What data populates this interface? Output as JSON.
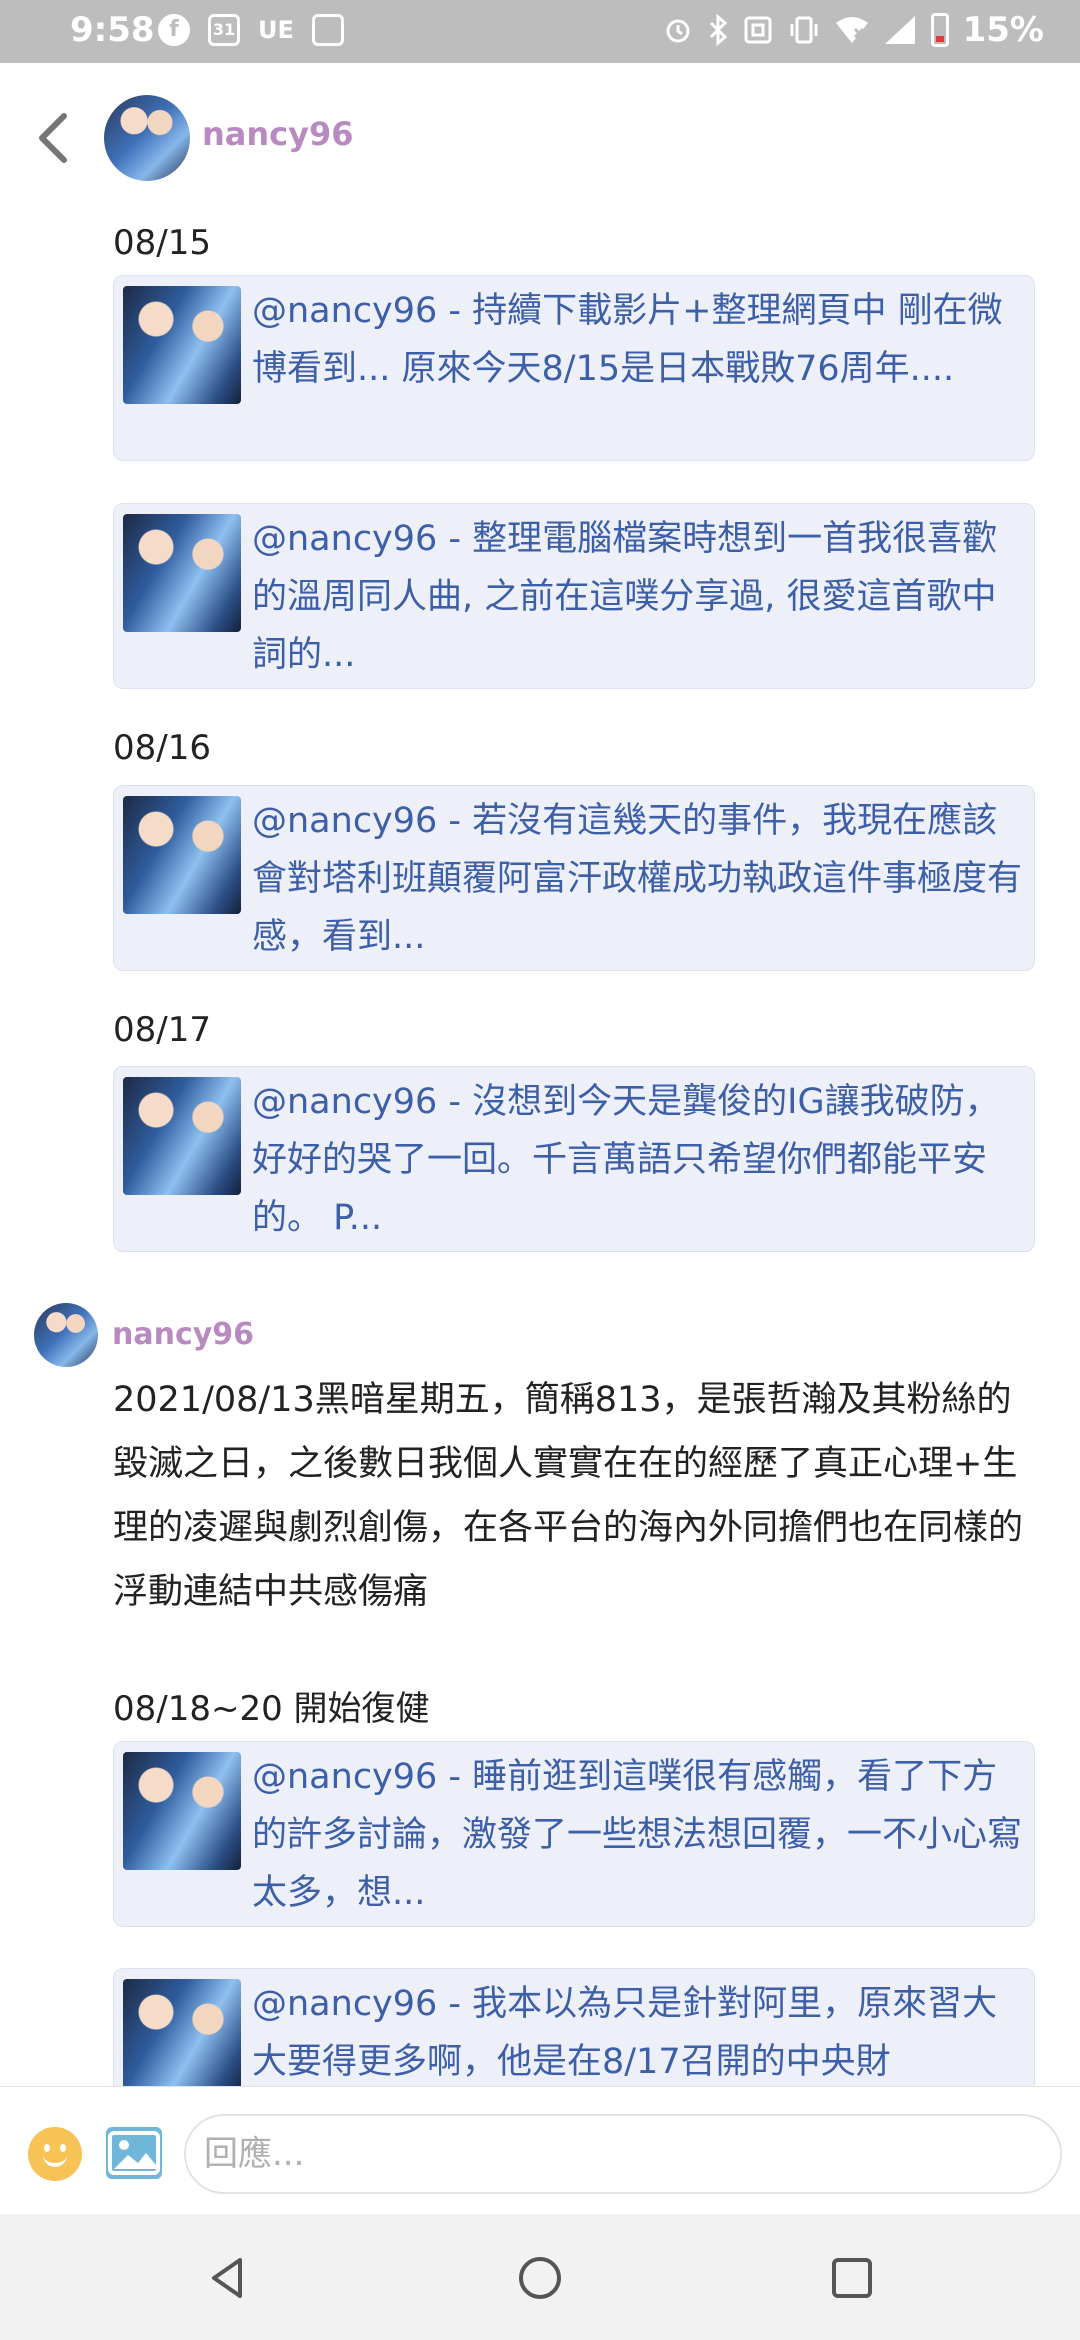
{
  "status_bar": {
    "time": "9:58",
    "left_icons": [
      "facebook-icon",
      "calendar-icon",
      "ue-icon",
      "image-icon"
    ],
    "calendar_day": "31",
    "ue_label": "UE",
    "right_icons": [
      "alarm-icon",
      "bluetooth-icon",
      "nfc-icon",
      "vibrate-icon",
      "wifi-icon",
      "signal-icon",
      "battery-icon"
    ],
    "battery": "15%"
  },
  "header": {
    "username": "nancy96"
  },
  "sections_top": [
    {
      "date": "08/15",
      "cards": [
        {
          "text": "@nancy96 - 持續下載影片+整理網頁中 剛在微博看到... 原來今天8/15是日本戰敗76周年...."
        },
        {
          "text": "@nancy96 - 整理電腦檔案時想到一首我很喜歡的溫周同人曲, 之前在這噗分享過, 很愛這首歌中詞的..."
        }
      ]
    },
    {
      "date": "08/16",
      "cards": [
        {
          "text": "@nancy96 - 若沒有這幾天的事件，我現在應該會對塔利班顛覆阿富汗政權成功執政這件事極度有感，看到..."
        }
      ]
    },
    {
      "date": "08/17",
      "cards": [
        {
          "text": "@nancy96 - 沒想到今天是龔俊的IG讓我破防，好好的哭了一回。千言萬語只希望你們都能平安的。 P..."
        }
      ]
    }
  ],
  "reply": {
    "username": "nancy96",
    "body": "2021/08/13黑暗星期五，簡稱813，是張哲瀚及其粉絲的毀滅之日，之後數日我個人實實在在的經歷了真正心理+生理的凌遲與劇烈創傷，在各平台的海內外同擔們也在同樣的浮動連結中共感傷痛",
    "section_date": "08/18~20 開始復健",
    "cards": [
      {
        "text": "@nancy96 - 睡前逛到這噗很有感觸，看了下方的許多討論，激發了一些想法想回覆，一不小心寫太多，想..."
      },
      {
        "text": "@nancy96 - 我本以為只是針對阿里，原來習大大要得更多啊，他是在8/17召開的中央財"
      }
    ]
  },
  "reply_bar": {
    "placeholder": "回應..."
  },
  "nav_bar": {
    "buttons": [
      "back-triangle-icon",
      "home-circle-icon",
      "recents-square-icon"
    ]
  }
}
